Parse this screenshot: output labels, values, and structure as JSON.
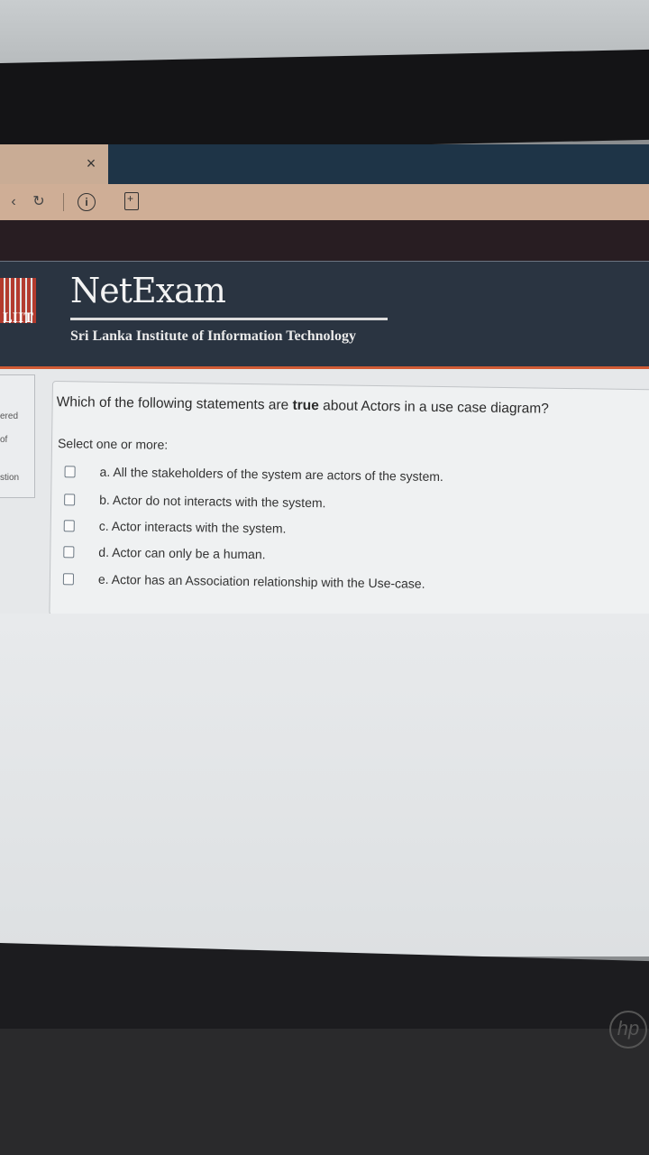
{
  "browser": {
    "tab_close_glyph": "×",
    "back_glyph": "‹",
    "reload_glyph": "↻",
    "info_glyph": "i"
  },
  "site": {
    "name": "NetExam",
    "logo_text": "LIIT",
    "institute": "Sri Lanka Institute of Information Technology",
    "accent_color": "#d15b35",
    "header_color": "#2a3441"
  },
  "side_panel": {
    "line1": "ered",
    "line2": "of",
    "line3": "stion"
  },
  "question": {
    "text_before": "Which of the following statements are ",
    "text_bold": "true",
    "text_after": " about Actors in a use case diagram?",
    "prompt": "Select one or more:",
    "options": [
      {
        "label": "a. All the stakeholders of the system are actors of the system.",
        "checked": false
      },
      {
        "label": "b. Actor do not interacts with the system.",
        "checked": false
      },
      {
        "label": "c. Actor interacts with the system.",
        "checked": false
      },
      {
        "label": "d. Actor can only be a human.",
        "checked": false
      },
      {
        "label": "e. Actor has an Association relationship with the Use-case.",
        "checked": false
      }
    ]
  },
  "device": {
    "brand": "hp"
  }
}
